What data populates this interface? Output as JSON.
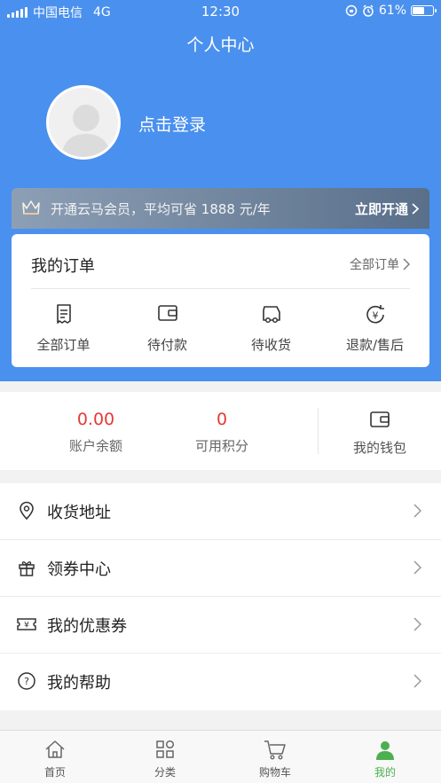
{
  "status_bar": {
    "carrier": "中国电信",
    "network": "4G",
    "time": "12:30",
    "battery": "61%",
    "battery_level": 0.61
  },
  "header": {
    "title": "个人中心",
    "login_label": "点击登录"
  },
  "vip": {
    "text": "开通云马会员，平均可省 1888 元/年",
    "button": "立即开通"
  },
  "orders": {
    "title": "我的订单",
    "view_all": "全部订单",
    "items": [
      {
        "label": "全部订单",
        "icon": "receipt-icon"
      },
      {
        "label": "待付款",
        "icon": "wallet-icon"
      },
      {
        "label": "待收货",
        "icon": "truck-icon"
      },
      {
        "label": "退款/售后",
        "icon": "refund-icon"
      }
    ]
  },
  "stats": {
    "balance_value": "0.00",
    "balance_label": "账户余额",
    "points_value": "0",
    "points_label": "可用积分",
    "wallet_label": "我的钱包"
  },
  "menu": [
    {
      "label": "收货地址",
      "icon": "location-pin-icon"
    },
    {
      "label": "领券中心",
      "icon": "gift-icon"
    },
    {
      "label": "我的优惠券",
      "icon": "coupon-icon"
    },
    {
      "label": "我的帮助",
      "icon": "help-icon"
    }
  ],
  "tabbar": [
    {
      "label": "首页",
      "icon": "home-icon",
      "active": false
    },
    {
      "label": "分类",
      "icon": "category-icon",
      "active": false
    },
    {
      "label": "购物车",
      "icon": "cart-icon",
      "active": false
    },
    {
      "label": "我的",
      "icon": "user-icon",
      "active": true
    }
  ],
  "colors": {
    "primary": "#4a90ee",
    "accent_red": "#e53935",
    "active_green": "#4caf50"
  }
}
